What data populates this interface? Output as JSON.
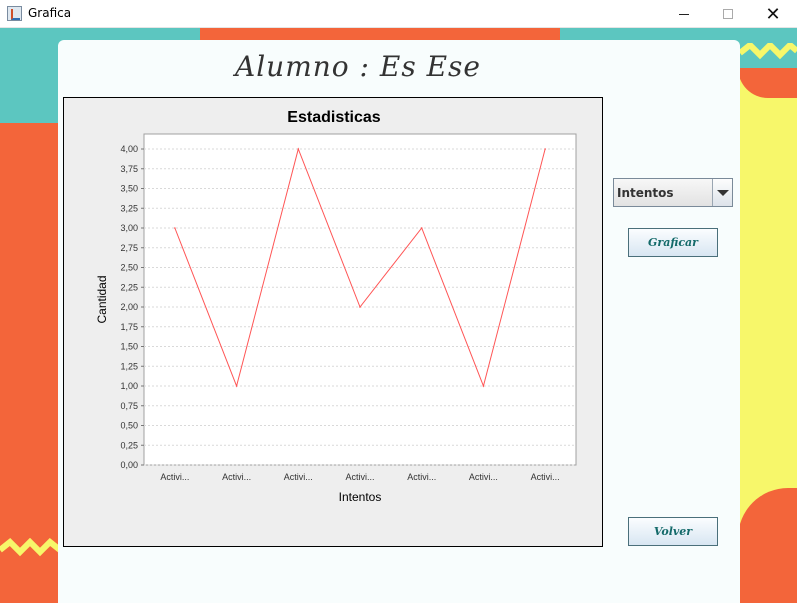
{
  "window": {
    "title": "Grafica",
    "close_glyph": "✕"
  },
  "header": {
    "student_title": "Alumno : Es Ese"
  },
  "controls": {
    "combo_value": "Intentos",
    "graficar_label": "Graficar",
    "volver_label": "Volver"
  },
  "colors": {
    "line": "#ff5555",
    "accent_text": "#146a6a"
  },
  "chart_data": {
    "type": "line",
    "title": "Estadisticas",
    "xlabel": "Intentos",
    "ylabel": "Cantidad",
    "categories": [
      "Activi...",
      "Activi...",
      "Activi...",
      "Activi...",
      "Activi...",
      "Activi...",
      "Activi..."
    ],
    "series": [
      {
        "values": [
          3.0,
          1.0,
          4.0,
          2.0,
          3.0,
          1.0,
          4.0
        ]
      }
    ],
    "ylim": [
      0,
      4.0
    ],
    "yticks": [
      "0,00",
      "0,25",
      "0,50",
      "0,75",
      "1,00",
      "1,25",
      "1,50",
      "1,75",
      "2,00",
      "2,25",
      "2,50",
      "2,75",
      "3,00",
      "3,25",
      "3,50",
      "3,75",
      "4,00"
    ],
    "grid": true
  }
}
